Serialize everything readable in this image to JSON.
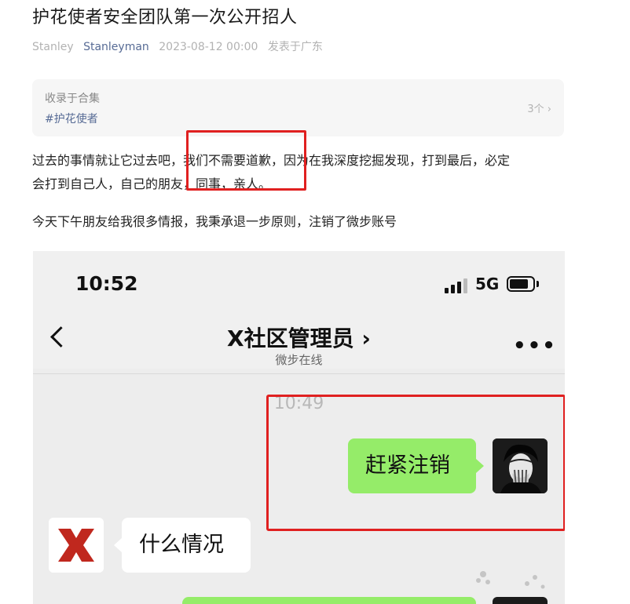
{
  "article": {
    "title": "护花使者安全团队第一次公开招人",
    "author": "Stanley",
    "account": "Stanleyman",
    "datetime": "2023-08-12 00:00",
    "location": "发表于广东"
  },
  "collection": {
    "label": "收录于合集",
    "tag": "#护花使者",
    "count": "3个"
  },
  "body": {
    "p1_line1": "过去的事情就让它过去吧，我们不需要道歉，因为在我深度挖掘发现，打到最后，必定",
    "p1_line2": "会打到自己人，自己的朋友，同事，亲人。",
    "p2": "今天下午朋友给我很多情报，我秉承退一步原则，注销了微步账号"
  },
  "screenshot": {
    "time": "10:52",
    "network": "5G",
    "contact_name": "X社区管理员 ›",
    "contact_status": "微步在线",
    "message_time": "10:49",
    "messages": [
      {
        "side": "out",
        "text": "赶紧注销"
      },
      {
        "side": "in",
        "text": "什么情况"
      }
    ],
    "icons": [
      "chevron-left-icon",
      "more-icon",
      "signal-icon",
      "battery-icon"
    ]
  },
  "colors": {
    "highlight_box": "#e02020",
    "bubble_out": "#95ec69",
    "link": "#576b95",
    "brand_x": "#c0281e"
  }
}
